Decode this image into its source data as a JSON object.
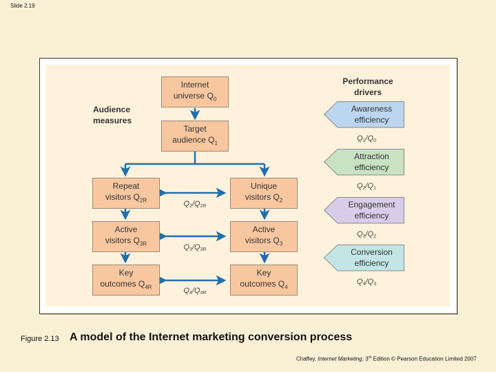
{
  "slide": {
    "label": "Slide 2.19"
  },
  "diagram": {
    "headings": {
      "audience": [
        "Audience",
        "measures"
      ],
      "performance": [
        "Performance",
        "drivers"
      ]
    },
    "boxes": {
      "internet_universe": {
        "line1": "Internet",
        "line2": "universe Q",
        "sub": "0"
      },
      "target_audience": {
        "line1": "Target",
        "line2": "audience Q",
        "sub": "1"
      },
      "repeat_visitors": {
        "line1": "Repeat",
        "line2": "visitors Q",
        "sub": "2R"
      },
      "unique_visitors": {
        "line1": "Unique",
        "line2": "visitors Q",
        "sub": "2"
      },
      "active_visitors_r": {
        "line1": "Active",
        "line2": "visitors Q",
        "sub": "3R"
      },
      "active_visitors": {
        "line1": "Active",
        "line2": "visitors Q",
        "sub": "3"
      },
      "key_outcomes_r": {
        "line1": "Key",
        "line2": "outcomes Q",
        "sub": "4R"
      },
      "key_outcomes": {
        "line1": "Key",
        "line2": "outcomes Q",
        "sub": "4"
      }
    },
    "middle_ratios": [
      {
        "num": "2",
        "den": "2R"
      },
      {
        "num": "3",
        "den": "3R"
      },
      {
        "num": "4",
        "den": "4R"
      }
    ],
    "drivers": [
      {
        "line1": "Awareness",
        "line2": "efficiency",
        "color": "#bcd6ef",
        "ratio_num": "1",
        "ratio_den": "0"
      },
      {
        "line1": "Attraction",
        "line2": "efficiency",
        "color": "#c9e2c2",
        "ratio_num": "2",
        "ratio_den": "1"
      },
      {
        "line1": "Engagement",
        "line2": "efficiency",
        "color": "#d7cde8",
        "ratio_num": "3",
        "ratio_den": "2"
      },
      {
        "line1": "Conversion",
        "line2": "efficiency",
        "color": "#c3e5e6",
        "ratio_num": "4",
        "ratio_den": "3"
      }
    ],
    "colors": {
      "arrow": "#1f6fad",
      "box_fill": "#f8c7a0",
      "panel": "#fff2dc"
    }
  },
  "caption": {
    "figure_label": "Figure 2.13",
    "title": "A model of the Internet marketing conversion process"
  },
  "credit": {
    "author": "Chaffey, ",
    "book": "Internet Marketing",
    "edition": ", 3",
    "edition_sup": "rd",
    "rest": " Edition © Pearson Education Limited 2007"
  }
}
